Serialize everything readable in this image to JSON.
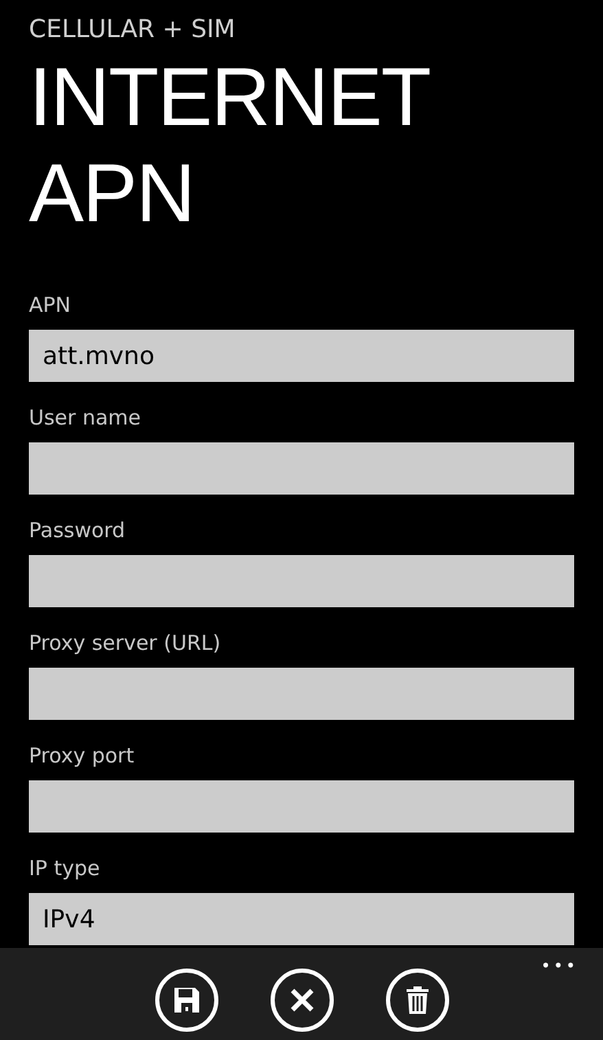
{
  "header": {
    "section": "CELLULAR + SIM",
    "title": "INTERNET APN"
  },
  "fields": [
    {
      "label": "APN",
      "value": "att.mvno"
    },
    {
      "label": "User name"
    },
    {
      "label": "Password"
    },
    {
      "label": "Proxy server (URL)"
    },
    {
      "label": "Proxy port"
    },
    {
      "label": "IP type",
      "value": "IPv4"
    }
  ],
  "app_bar": {
    "buttons": [
      {
        "kind": "save"
      },
      {
        "kind": "cancel"
      },
      {
        "kind": "delete"
      }
    ],
    "more": "•••"
  }
}
